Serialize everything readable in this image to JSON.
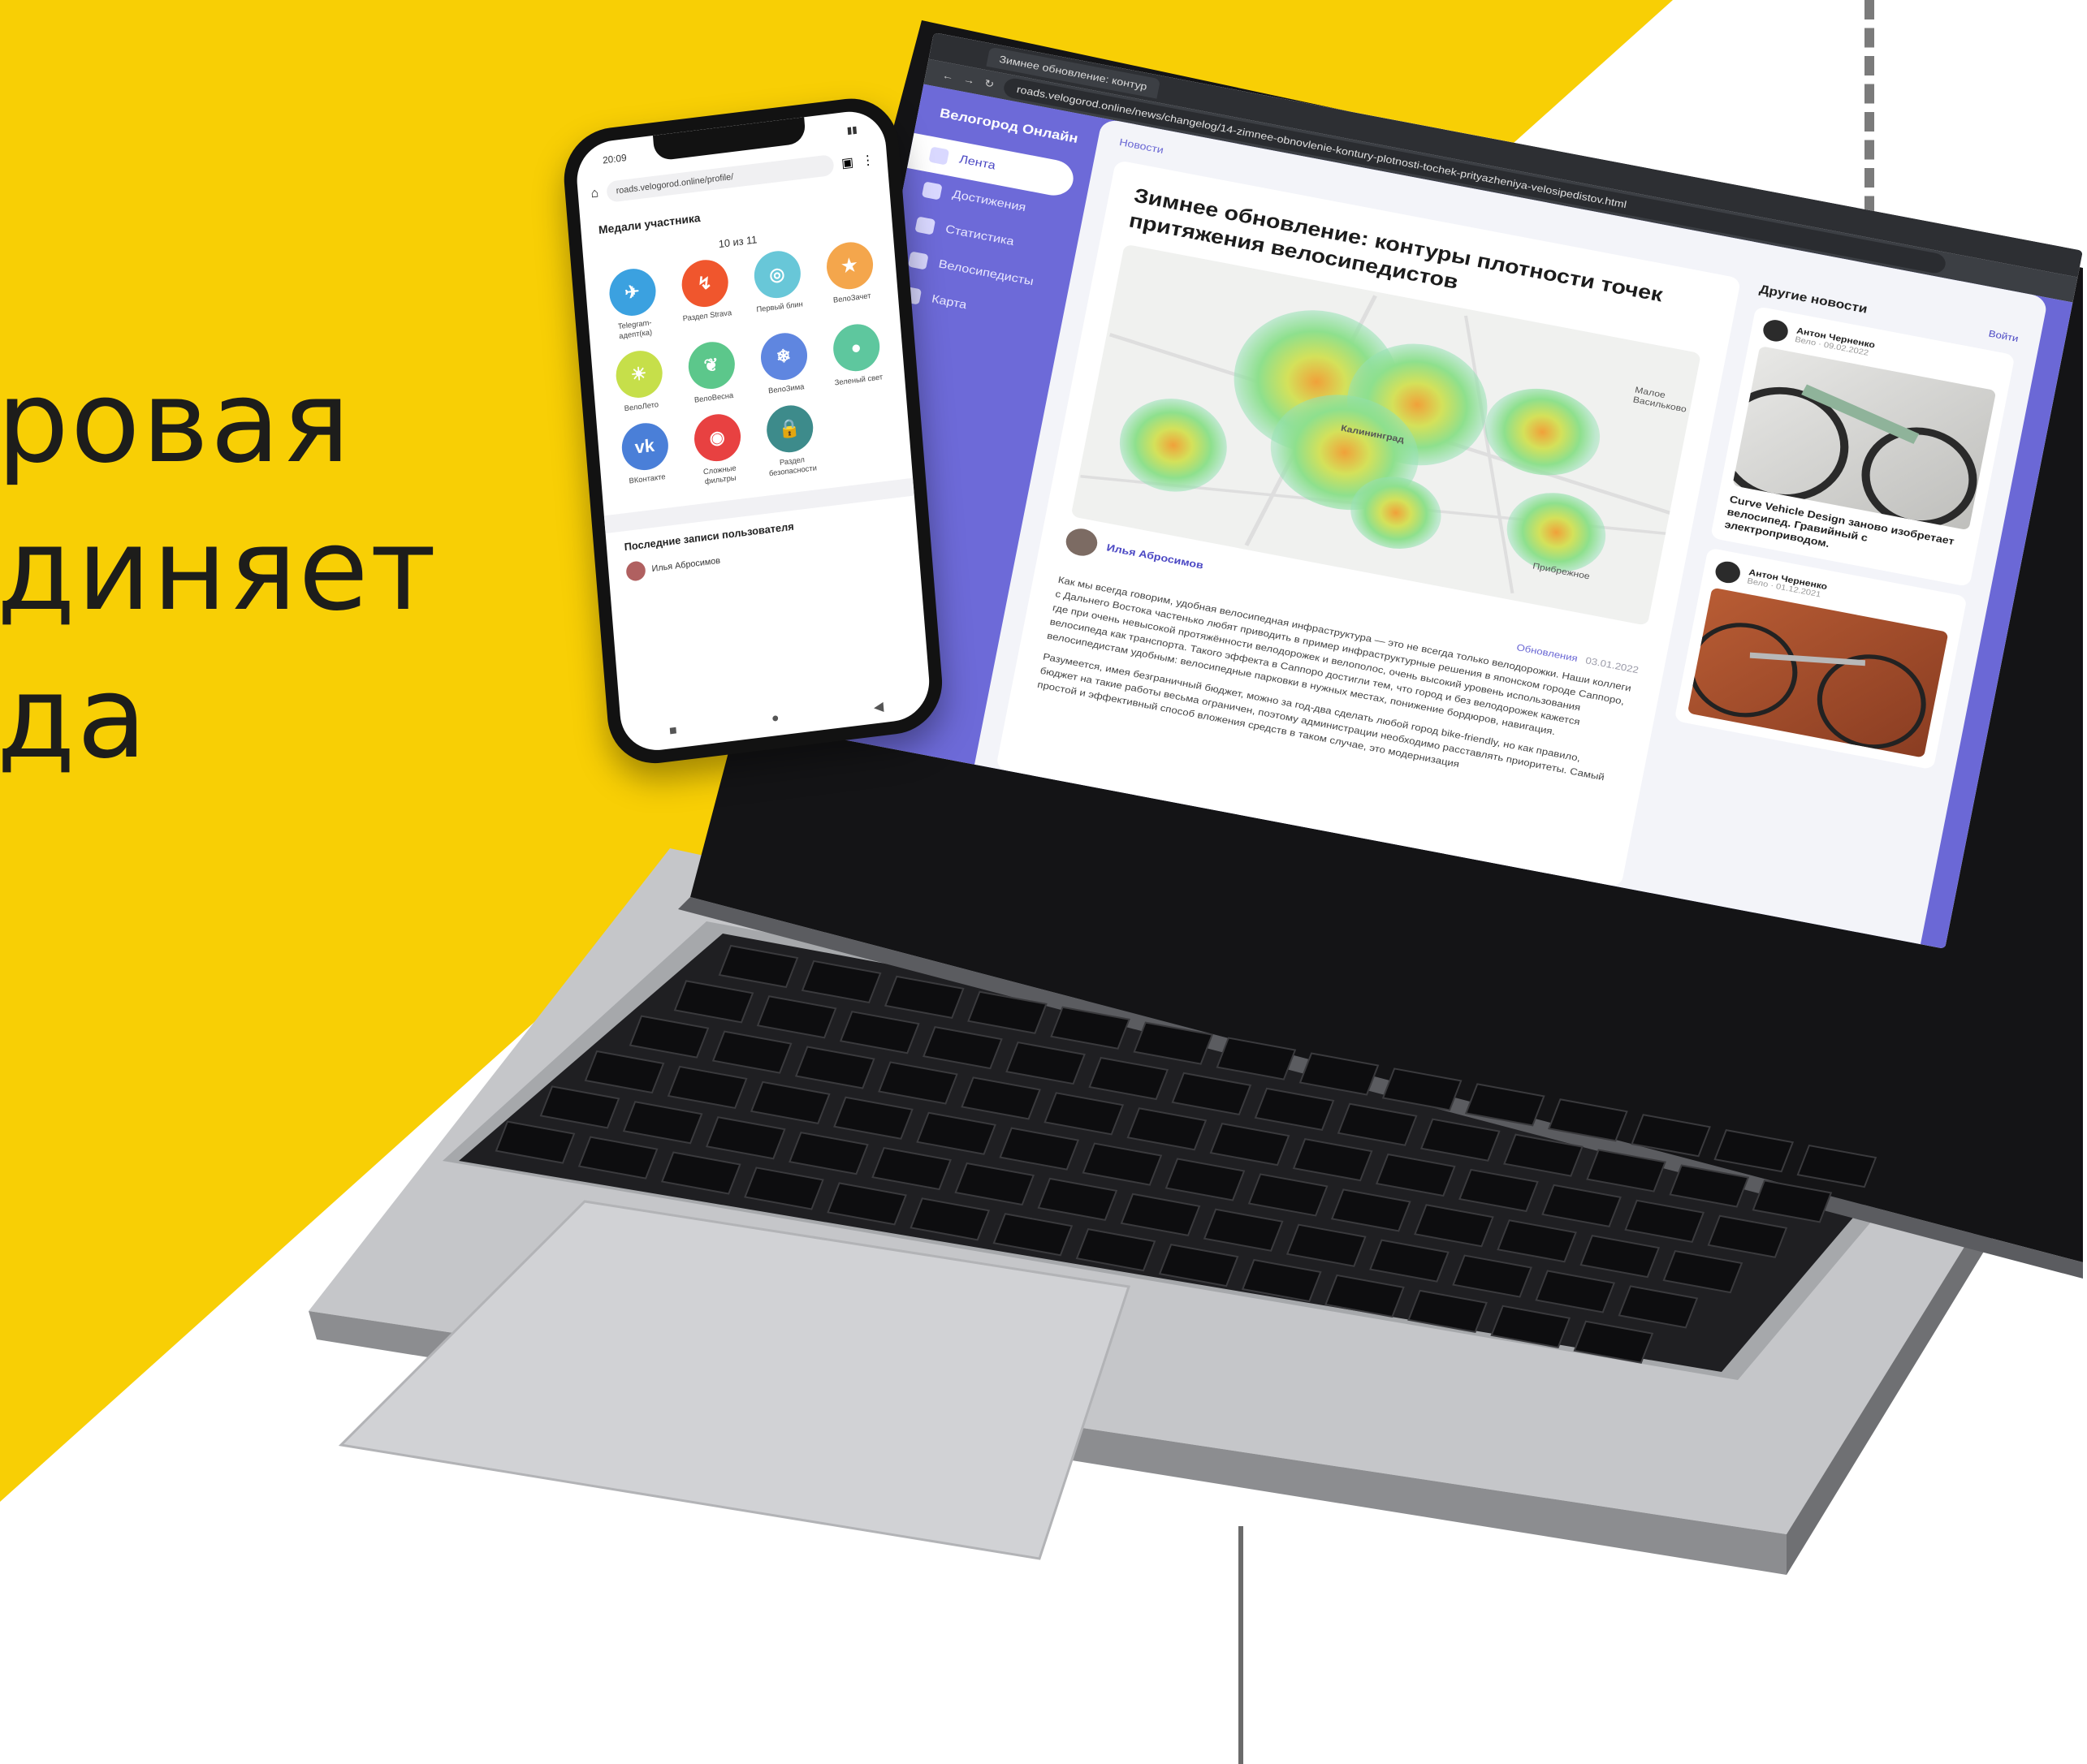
{
  "hero": {
    "lines": [
      "ровая",
      "диняет",
      "да"
    ]
  },
  "colors": {
    "yellow": "#f8cf05",
    "accent": "#6b68d6",
    "text_dark": "#1d1d1b"
  },
  "browser": {
    "tab_title": "Зимнее обновление: контур",
    "url": "roads.velogorod.online/news/changelog/14-zimnee-obnovlenie-kontury-plotnosti-tochek-prityazheniya-velosipedistov.html"
  },
  "site": {
    "brand": "Велогород Онлайн",
    "nav": [
      {
        "label": "Лента",
        "icon": "feed-icon"
      },
      {
        "label": "Достижения",
        "icon": "medal-icon"
      },
      {
        "label": "Статистика",
        "icon": "stats-icon"
      },
      {
        "label": "Велосипедисты",
        "icon": "users-icon"
      },
      {
        "label": "Карта",
        "icon": "map-icon"
      }
    ],
    "breadcrumb": "Новости",
    "article": {
      "title": "Зимнее обновление: контуры плотности точек притяжения велосипедистов",
      "map_labels": [
        "Калининград",
        "Прибрежное",
        "Малое Васильково"
      ],
      "author": "Илья Абросимов",
      "category": "Обновления",
      "date": "03.01.2022",
      "paragraph1": "Как мы всегда говорим, удобная велосипедная инфраструктура — это не всегда только велодорожки. Наши коллеги с Дальнего Востока частенько любят приводить в пример инфраструктурные решения в японском городе Саппоро, где при очень невысокой протяжённости велодорожек и велополос, очень высокий уровень использования велосипеда как транспорта. Такого эффекта в Саппоро достигли тем, что город и без велодорожек кажется велосипедистам удобным: велосипедные парковки в нужных местах, понижение бордюров, навигация.",
      "paragraph2": "Разумеется, имея безграничный бюджет, можно за год-два сделать любой город bike-friendly, но как правило, бюджет на такие работы весьма ограничен, поэтому администрации необходимо расставлять приоритеты. Самый простой и эффективный способ вложения средств в таком случае, это модернизация"
    },
    "aside": {
      "title": "Другие новости",
      "login": "Войти",
      "cards": [
        {
          "author": "Антон Черненко",
          "date": "Вело · 09.02.2022",
          "text": "Curve Vehicle Design заново изобретает велосипед. Гравийный с электроприводом."
        },
        {
          "author": "Антон Черненко",
          "date": "Вело · 01.12.2021",
          "text": ""
        }
      ]
    }
  },
  "phone": {
    "time": "20:09",
    "url": "roads.velogorod.online/profile/",
    "medals_title": "Медали участника",
    "medals_count": "10 из 11",
    "medals": [
      {
        "label": "Telegram-адепт(ка)",
        "color": "#3ba1e0",
        "icon": "telegram-icon"
      },
      {
        "label": "Раздел Strava",
        "color": "#f0562d",
        "icon": "strava-icon"
      },
      {
        "label": "Первый блин",
        "color": "#68c7d8",
        "icon": "pancake-icon"
      },
      {
        "label": "ВелоЗачет",
        "color": "#f4a64c",
        "icon": "trophy-icon"
      },
      {
        "label": "ВелоЛето",
        "color": "#c6df4a",
        "icon": "sun-icon"
      },
      {
        "label": "ВелоВесна",
        "color": "#5cc78b",
        "icon": "leaf-icon"
      },
      {
        "label": "ВелоЗима",
        "color": "#5f86e0",
        "icon": "snow-icon"
      },
      {
        "label": "Зеленый свет",
        "color": "#5ec79e",
        "icon": "traffic-light-icon"
      },
      {
        "label": "ВКонтакте",
        "color": "#4a7fd8",
        "icon": "vk-icon"
      },
      {
        "label": "Сложные фильтры",
        "color": "#e84141",
        "icon": "filter-icon"
      },
      {
        "label": "Раздел безопасности",
        "color": "#3d8b8b",
        "icon": "lock-icon"
      }
    ],
    "recent_title": "Последние записи пользователя",
    "recent_author": "Илья Абросимов"
  }
}
